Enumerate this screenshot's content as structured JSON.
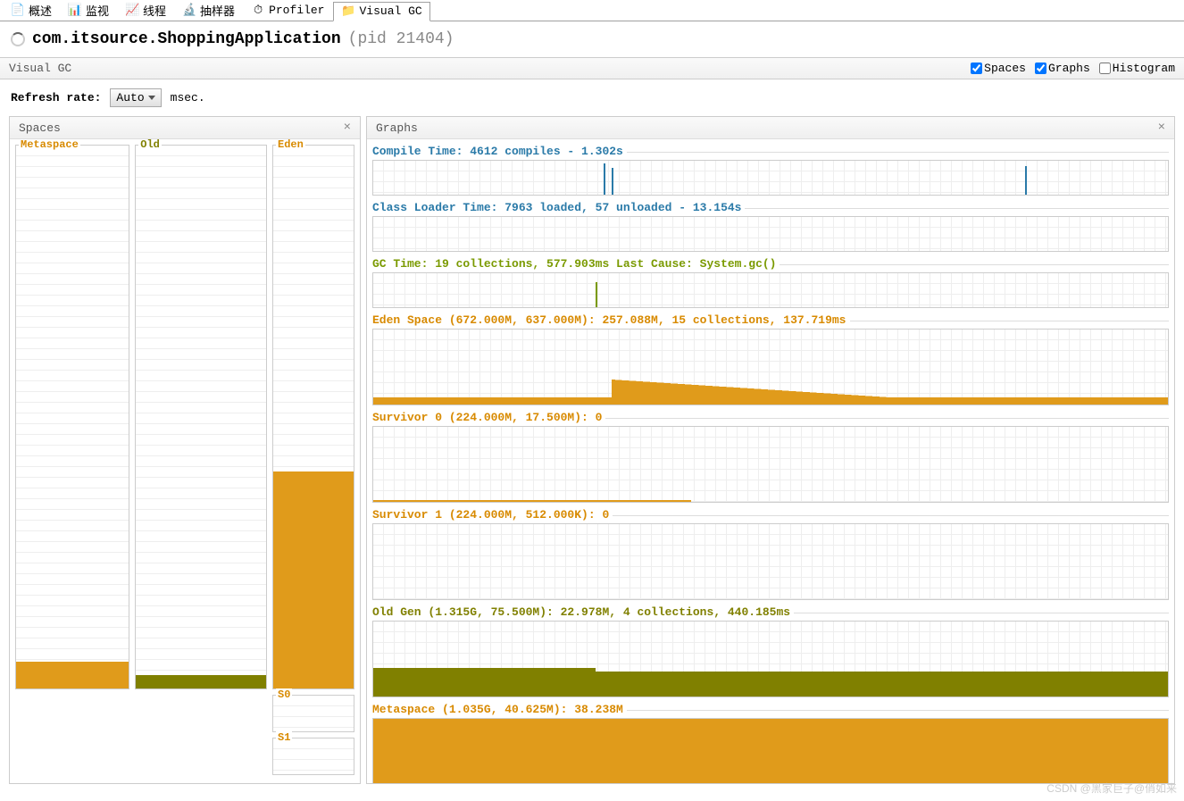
{
  "tabs": [
    {
      "label": "概述"
    },
    {
      "label": "监视"
    },
    {
      "label": "线程"
    },
    {
      "label": "抽样器"
    },
    {
      "label": "Profiler"
    },
    {
      "label": "Visual GC"
    }
  ],
  "activeTab": 5,
  "appTitle": "com.itsource.ShoppingApplication",
  "pidText": "(pid 21404)",
  "subbarTitle": "Visual GC",
  "checks": {
    "spaces": "Spaces",
    "graphs": "Graphs",
    "histogram": "Histogram"
  },
  "refresh": {
    "label": "Refresh rate:",
    "value": "Auto",
    "unit": "msec."
  },
  "panels": {
    "spaces": "Spaces",
    "graphs": "Graphs"
  },
  "spaces": {
    "metaspace": {
      "label": "Metaspace",
      "fillPct": 5
    },
    "old": {
      "label": "Old",
      "fillPct": 2.5
    },
    "eden": {
      "label": "Eden",
      "fillPct": 40
    },
    "s0": {
      "label": "S0"
    },
    "s1": {
      "label": "S1"
    }
  },
  "graphs": {
    "compile": {
      "title": "Compile Time: 4612 compiles - 1.302s"
    },
    "classloader": {
      "title": "Class Loader Time: 7963 loaded, 57 unloaded - 13.154s"
    },
    "gc": {
      "title": "GC Time: 19 collections, 577.903ms Last Cause: System.gc()"
    },
    "eden": {
      "title": "Eden Space (672.000M, 637.000M): 257.088M, 15 collections, 137.719ms"
    },
    "surv0": {
      "title": "Survivor 0 (224.000M, 17.500M): 0"
    },
    "surv1": {
      "title": "Survivor 1 (224.000M, 512.000K): 0"
    },
    "oldgen": {
      "title": "Old Gen (1.315G, 75.500M): 22.978M, 4 collections, 440.185ms"
    },
    "metaspace": {
      "title": "Metaspace (1.035G, 40.625M): 38.238M"
    }
  },
  "chart_data": {
    "spaces": [
      {
        "name": "Metaspace",
        "fill_pct": 5,
        "color": "#e09b1b"
      },
      {
        "name": "Old",
        "fill_pct": 2.5,
        "color": "#808000"
      },
      {
        "name": "Eden",
        "fill_pct": 40,
        "color": "#e09b1b"
      },
      {
        "name": "S0",
        "fill_pct": 0,
        "color": "#e09b1b"
      },
      {
        "name": "S1",
        "fill_pct": 0,
        "color": "#e09b1b"
      }
    ],
    "graphs": [
      {
        "name": "Compile Time",
        "compiles": 4612,
        "time_s": 1.302
      },
      {
        "name": "Class Loader Time",
        "loaded": 7963,
        "unloaded": 57,
        "time_s": 13.154
      },
      {
        "name": "GC Time",
        "collections": 19,
        "time_ms": 577.903,
        "last_cause": "System.gc()"
      },
      {
        "name": "Eden Space",
        "max_M": 672.0,
        "committed_M": 637.0,
        "used_M": 257.088,
        "collections": 15,
        "time_ms": 137.719
      },
      {
        "name": "Survivor 0",
        "max_M": 224.0,
        "committed_M": 17.5,
        "used": 0
      },
      {
        "name": "Survivor 1",
        "max_M": 224.0,
        "committed_K": 512.0,
        "used": 0
      },
      {
        "name": "Old Gen",
        "max_G": 1.315,
        "committed_M": 75.5,
        "used_M": 22.978,
        "collections": 4,
        "time_ms": 440.185
      },
      {
        "name": "Metaspace",
        "max_G": 1.035,
        "committed_M": 40.625,
        "used_M": 38.238
      }
    ]
  },
  "watermark": "CSDN @黑家巨子@俏如来"
}
